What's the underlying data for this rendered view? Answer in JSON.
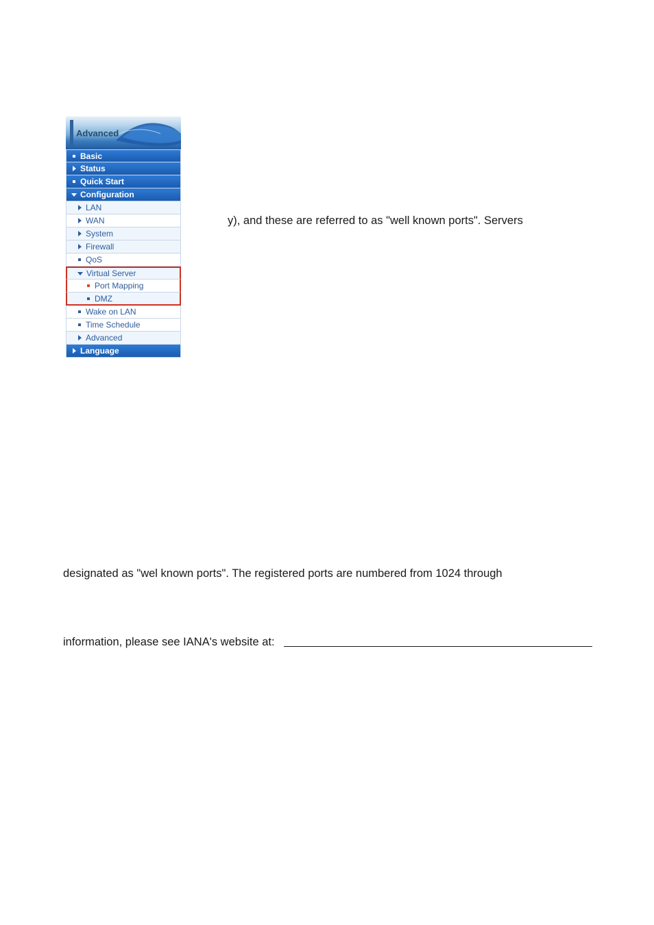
{
  "sidebar": {
    "header": "Advanced",
    "items": [
      {
        "label": "Basic",
        "icon": "bullet-white",
        "cls": "blue-bg"
      },
      {
        "label": "Status",
        "icon": "arrow-r-white",
        "cls": "blue-bg"
      },
      {
        "label": "Quick Start",
        "icon": "bullet-white",
        "cls": "blue-bg"
      },
      {
        "label": "Configuration",
        "icon": "arrow-d-white",
        "cls": "blue-bg"
      },
      {
        "label": "LAN",
        "icon": "arrow-r-blue",
        "cls": "light-bg ind1"
      },
      {
        "label": "WAN",
        "icon": "arrow-r-blue",
        "cls": "white-bg ind1"
      },
      {
        "label": "System",
        "icon": "arrow-r-blue",
        "cls": "light-bg ind1"
      },
      {
        "label": "Firewall",
        "icon": "arrow-r-blue",
        "cls": "light-bg ind1"
      },
      {
        "label": "QoS",
        "icon": "bullet-blue",
        "cls": "white-bg ind1"
      },
      {
        "label": "Virtual Server",
        "icon": "arrow-d-blue",
        "cls": "light-bg ind1",
        "redTop": true
      },
      {
        "label": "Port Mapping",
        "icon": "bullet-red",
        "cls": "white-bg ind2",
        "redMid": true
      },
      {
        "label": "DMZ",
        "icon": "bullet-blue",
        "cls": "light-bg ind2",
        "redBot": true
      },
      {
        "label": "Wake on LAN",
        "icon": "bullet-blue",
        "cls": "white-bg ind1"
      },
      {
        "label": "Time Schedule",
        "icon": "bullet-blue",
        "cls": "white-bg ind1"
      },
      {
        "label": "Advanced",
        "icon": "arrow-r-blue",
        "cls": "light-bg ind1"
      },
      {
        "label": "Language",
        "icon": "arrow-r-white",
        "cls": "blue-bg"
      }
    ]
  },
  "body": {
    "line1": "y), and these are referred to as \"well known ports\". Servers",
    "line2": "designated as \"wel  known ports\". The registered ports are numbered from 1024 through",
    "line3": "information, please see IANA's website at:"
  }
}
